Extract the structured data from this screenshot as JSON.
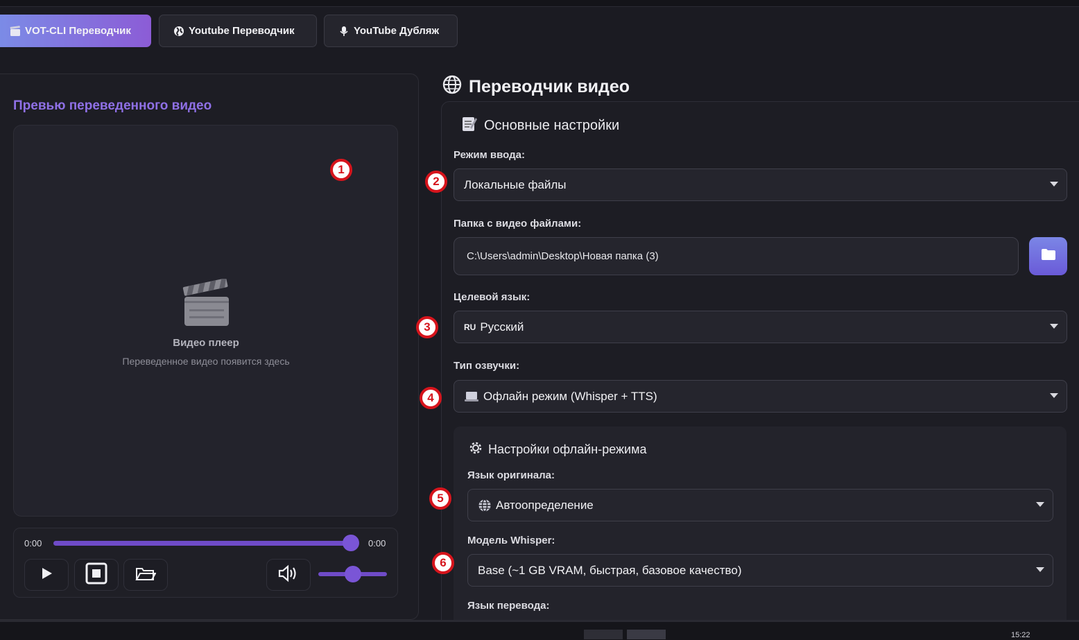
{
  "tabs": [
    {
      "label": "VOT-CLI Переводчик",
      "icon": "clapper-icon",
      "active": true
    },
    {
      "label": "Youtube Переводчик",
      "icon": "globe-icon",
      "active": false
    },
    {
      "label": "YouTube Дубляж",
      "icon": "mic-icon",
      "active": false
    }
  ],
  "left": {
    "preview_title": "Превью переведенного видео",
    "player_title": "Видео плеер",
    "player_subtitle": "Переведенное видео появится здесь",
    "time_current": "0:00",
    "time_total": "0:00",
    "seek_position": 1.0,
    "volume_level": 0.5
  },
  "right": {
    "title": "Переводчик видео",
    "section_title": "Основные настройки",
    "input_mode_label": "Режим ввода:",
    "input_mode_value": "Локальные файлы",
    "folder_label": "Папка с видео файлами:",
    "folder_value": "C:\\Users\\admin\\Desktop\\Новая папка (3)",
    "target_lang_label": "Целевой язык:",
    "target_lang_prefix": "RU",
    "target_lang_value": "Русский",
    "voice_type_label": "Тип озвучки:",
    "voice_type_value": "Офлайн режим (Whisper + TTS)",
    "offline": {
      "title": "Настройки офлайн-режима",
      "orig_lang_label": "Язык оригинала:",
      "orig_lang_value": "Автоопределение",
      "model_label": "Модель Whisper:",
      "model_value": "Base (~1 GB VRAM, быстрая, базовое качество)",
      "trans_lang_label": "Язык перевода:"
    }
  },
  "markers": [
    "1",
    "2",
    "3",
    "4",
    "5",
    "6"
  ],
  "taskbar": {
    "clock": "15:22"
  },
  "colors": {
    "accent": "#7a55d6",
    "marker": "#d6141c",
    "background": "#1b1b22"
  }
}
